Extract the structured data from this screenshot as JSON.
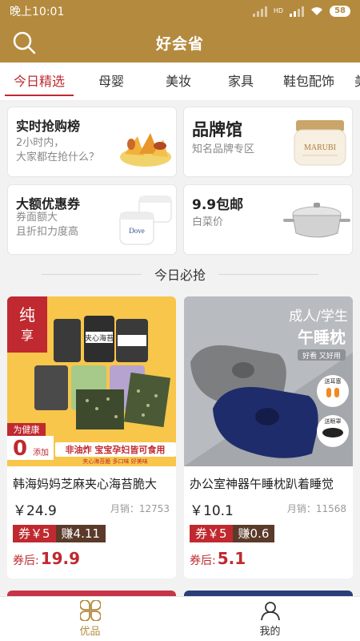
{
  "status": {
    "time": "晚上10:01",
    "battery": "58",
    "net": "HD"
  },
  "header": {
    "title": "好会省"
  },
  "tabs": [
    "今日精选",
    "母婴",
    "美妆",
    "家具",
    "鞋包配饰",
    "美"
  ],
  "cards": {
    "hot": {
      "title": "实时抢购榜",
      "sub1": "2小时内，",
      "sub2": "大家都在抢什么？"
    },
    "brand": {
      "title": "品牌馆",
      "sub": "知名品牌专区",
      "product_label": "MARUBI"
    },
    "coupon": {
      "title": "大额优惠券",
      "sub1": "券面额大",
      "sub2": "且折扣力度高"
    },
    "cheap": {
      "title": "9.9包邮",
      "sub": "白菜价"
    },
    "dove_label": "Dove"
  },
  "section_title": "今日必抢",
  "products": [
    {
      "name": "韩海妈妈芝麻夹心海苔脆大",
      "price": "￥24.9",
      "sales": "月销：12753",
      "coupon": "券￥5",
      "earn": "赚4.11",
      "after_label": "券后:",
      "after_price": "19.9",
      "img_text": {
        "banner": "非油炸  宝宝孕妇皆可食用",
        "sub": "夹心海苔脆  多口味  好美味",
        "health": "为健康",
        "zero": "0",
        "add": "添加",
        "can": "夹心海苔"
      }
    },
    {
      "name": "办公室神器午睡枕趴着睡觉",
      "price": "￥10.1",
      "sales": "月销：11568",
      "coupon": "券￥5",
      "earn": "赚0.6",
      "after_label": "券后:",
      "after_price": "5.1",
      "img_text": {
        "h1": "成人/学生",
        "h2": "午睡枕",
        "tag": "好看 又好用",
        "g1": "送耳塞",
        "g2": "送眼罩"
      }
    }
  ],
  "bottomnav": [
    {
      "label": "优品",
      "icon": "grid-flower-icon",
      "active": true
    },
    {
      "label": "我的",
      "icon": "user-icon",
      "active": false
    }
  ],
  "colors": {
    "brand": "#b48a3e",
    "accent": "#c0292f",
    "earn": "#5b3a2a"
  }
}
